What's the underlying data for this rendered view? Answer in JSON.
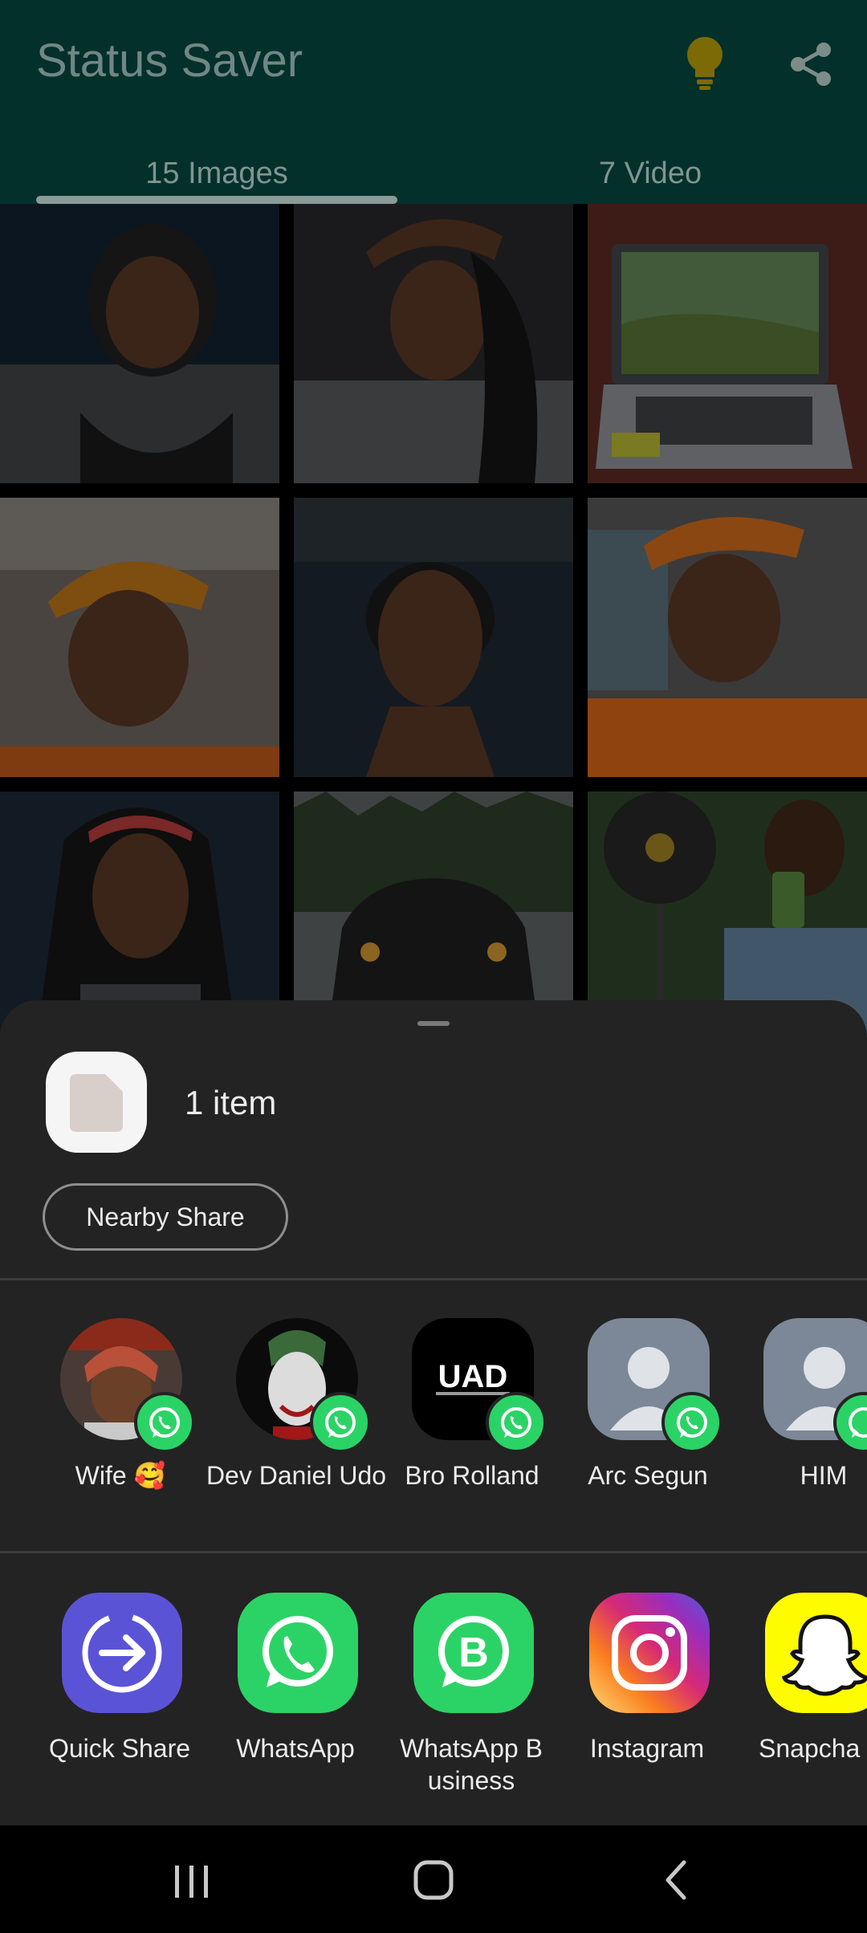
{
  "app": {
    "title": "Status Saver",
    "tabs": [
      {
        "label": "15 Images",
        "selected": true
      },
      {
        "label": "7 Video",
        "selected": false
      }
    ]
  },
  "grid": {
    "thumbnails": [
      {
        "subject": "woman-black-hijab"
      },
      {
        "subject": "woman-hand-on-head"
      },
      {
        "subject": "laptop-on-table"
      },
      {
        "subject": "woman-orange-cap"
      },
      {
        "subject": "woman-short-hair"
      },
      {
        "subject": "woman-orange-cap-2"
      },
      {
        "subject": "woman-red-headband"
      },
      {
        "subject": "black-car"
      },
      {
        "subject": "man-fan-selfie"
      }
    ]
  },
  "share_sheet": {
    "item_count": "1 item",
    "nearby_share_label": "Nearby Share",
    "contacts": [
      {
        "name": "Wife 🥰",
        "app_badge": "whatsapp-icon"
      },
      {
        "name": "Dev Daniel Udo",
        "app_badge": "whatsapp-icon"
      },
      {
        "name": "Bro Rolland",
        "app_badge": "whatsapp-icon"
      },
      {
        "name": "Arc Segun",
        "app_badge": "whatsapp-icon"
      },
      {
        "name": "HIM",
        "app_badge": "whatsapp-icon"
      }
    ],
    "apps": [
      {
        "name": "Quick Share",
        "icon": "quick-share-icon",
        "color": "#5b53d6"
      },
      {
        "name": "WhatsApp",
        "icon": "whatsapp-icon",
        "color": "#2bd366"
      },
      {
        "name": "WhatsApp B usiness",
        "icon": "whatsapp-business-icon",
        "color": "#2bd366"
      },
      {
        "name": "Instagram",
        "icon": "instagram-icon",
        "color": "#e1306c"
      },
      {
        "name": "Snapcha",
        "icon": "snapchat-icon",
        "color": "#fffc00"
      }
    ]
  },
  "navbar": {
    "buttons": [
      "recent-apps-icon",
      "home-icon",
      "back-icon"
    ]
  },
  "colors": {
    "app_bg": "#04302b",
    "sheet_bg": "#232323",
    "whatsapp_green": "#2bd366"
  }
}
